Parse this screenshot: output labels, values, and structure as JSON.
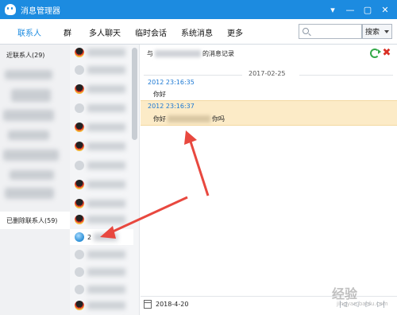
{
  "window": {
    "title": "消息管理器",
    "controls": [
      "▾",
      "—",
      "▢",
      "✕"
    ]
  },
  "nav": {
    "tabs": [
      "联系人",
      "群",
      "多人聊天",
      "临时会话",
      "系统消息",
      "更多"
    ],
    "active_tab": "联系人",
    "search_placeholder": "",
    "search_button": "搜索"
  },
  "left_column": {
    "top_label": "近联系人(29)",
    "deleted_label": "已删除联系人(59)"
  },
  "contacts": {
    "selected_label": "2"
  },
  "conversation": {
    "header_prefix": "与",
    "header_suffix": "的消息记录",
    "date_separator": "2017-02-25",
    "messages": [
      {
        "time": "2012 23:16:35",
        "text": "你好",
        "highlighted": false
      },
      {
        "time": "2012 23:16:37",
        "text_prefix": "你好",
        "text_suffix": "你吗",
        "highlighted": true
      }
    ],
    "footer_date": "2018-4-20",
    "pager": [
      "|◁",
      "◁",
      "▷",
      "▷|"
    ]
  },
  "colors": {
    "titlebar": "#1c8be0",
    "active_tab": "#1c8be0",
    "timestamp": "#1c78d3",
    "highlight_bg": "#fcebc7",
    "annotation_arrow": "#e8483f"
  },
  "watermark": {
    "text": "经验",
    "sub": "jingyan.baidu.com"
  }
}
